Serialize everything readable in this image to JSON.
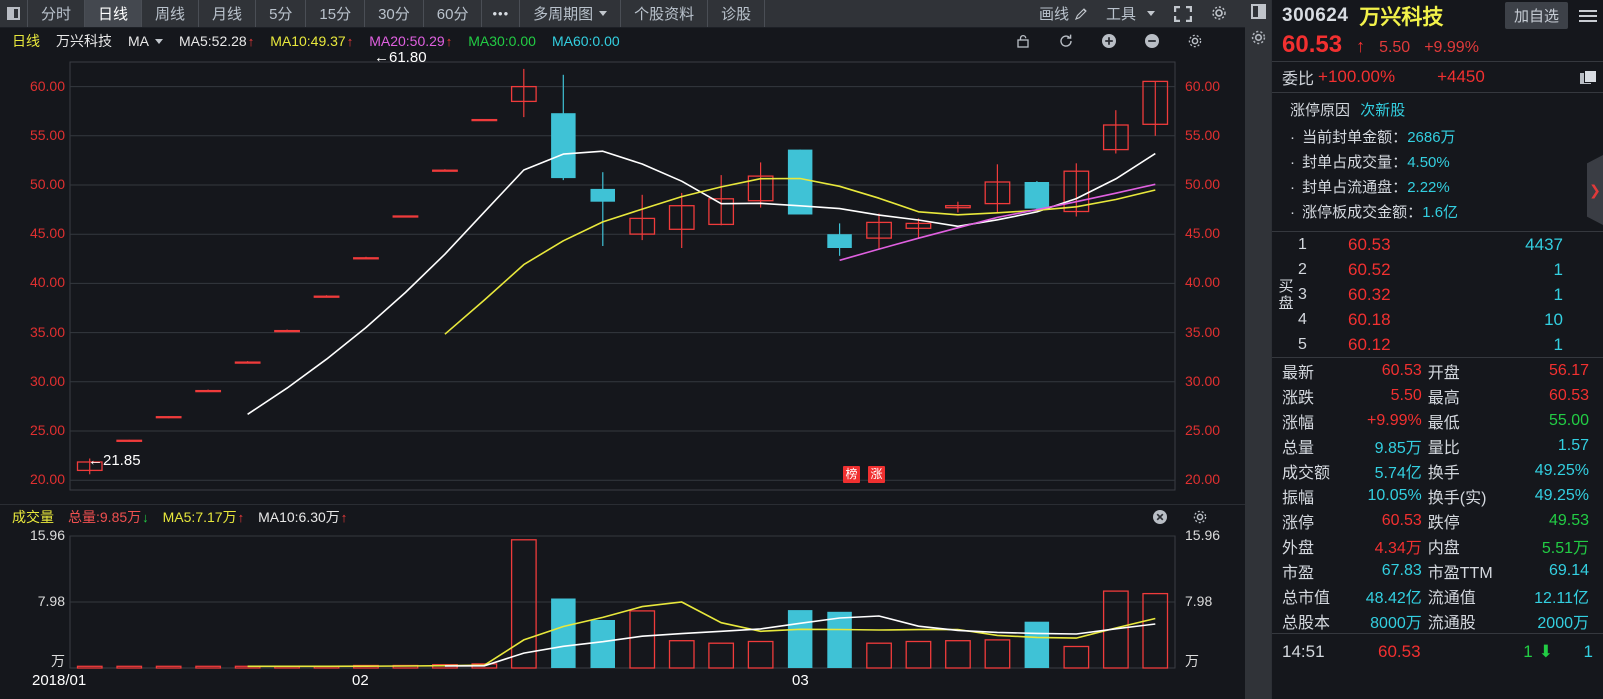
{
  "toolbar": {
    "panel_icon": "panel-toggle-icon",
    "tabs": [
      {
        "label": "分时",
        "active": false
      },
      {
        "label": "日线",
        "active": true
      },
      {
        "label": "周线",
        "active": false
      },
      {
        "label": "月线",
        "active": false
      },
      {
        "label": "5分",
        "active": false
      },
      {
        "label": "15分",
        "active": false
      },
      {
        "label": "30分",
        "active": false
      },
      {
        "label": "60分",
        "active": false
      }
    ],
    "more_label": "•••",
    "multi_period_label": "多周期图",
    "stock_info_label": "个股资料",
    "diagnose_label": "诊股",
    "draw_label": "画线",
    "tools_label": "工具"
  },
  "indicator_bar": {
    "period": "日线",
    "stock_name": "万兴科技",
    "ma_label": "MA",
    "ma5": "MA5:52.28",
    "ma10": "MA10:49.37",
    "ma20": "MA20:50.29",
    "ma30": "MA30:0.00",
    "ma60": "MA60:0.00"
  },
  "volume_header": {
    "title": "成交量",
    "total": "总量:9.85万",
    "ma5": "MA5:7.17万",
    "ma10": "MA10:6.30万"
  },
  "chart_data": {
    "type": "candlestick",
    "title": "万兴科技 300624 日线",
    "xlabel": "",
    "ylabel": "",
    "ylim": [
      19.0,
      62.5
    ],
    "y_ticks": [
      "60.00",
      "55.00",
      "50.00",
      "45.00",
      "40.00",
      "35.00",
      "30.00",
      "25.00",
      "20.00"
    ],
    "x_ticks": [
      "2018/01",
      "02",
      "03"
    ],
    "grid": true,
    "annotations": [
      {
        "text": "←61.80",
        "value": 61.8,
        "type": "high-marker"
      },
      {
        "text": "←21.85",
        "value": 21.85,
        "type": "low-marker"
      }
    ],
    "badges": [
      "榜",
      "涨"
    ],
    "legend": [
      {
        "name": "MA5",
        "color": "#ffffff",
        "value": 52.28
      },
      {
        "name": "MA10",
        "color": "#e8e83c",
        "value": 49.37
      },
      {
        "name": "MA20",
        "color": "#e060e0",
        "value": 50.29
      },
      {
        "name": "MA30",
        "color": "#22cc44",
        "value": 0.0
      },
      {
        "name": "MA60",
        "color": "#33cfe0",
        "value": 0.0
      }
    ],
    "candles": [
      {
        "o": 21.0,
        "h": 22.2,
        "l": 20.6,
        "c": 21.85,
        "dir": "up"
      },
      {
        "o": 24.0,
        "h": 24.1,
        "l": 23.9,
        "c": 24.05,
        "dir": "up"
      },
      {
        "o": 26.4,
        "h": 26.5,
        "l": 26.3,
        "c": 26.45,
        "dir": "up"
      },
      {
        "o": 29.1,
        "h": 29.2,
        "l": 29.0,
        "c": 29.1,
        "dir": "up"
      },
      {
        "o": 32.0,
        "h": 32.1,
        "l": 31.9,
        "c": 32.0,
        "dir": "up"
      },
      {
        "o": 35.2,
        "h": 35.3,
        "l": 35.1,
        "c": 35.2,
        "dir": "up"
      },
      {
        "o": 38.7,
        "h": 38.8,
        "l": 38.6,
        "c": 38.7,
        "dir": "up"
      },
      {
        "o": 42.6,
        "h": 42.7,
        "l": 42.5,
        "c": 42.6,
        "dir": "up"
      },
      {
        "o": 46.8,
        "h": 46.9,
        "l": 46.7,
        "c": 46.85,
        "dir": "up"
      },
      {
        "o": 51.5,
        "h": 51.6,
        "l": 51.4,
        "c": 51.5,
        "dir": "up"
      },
      {
        "o": 56.6,
        "h": 56.7,
        "l": 56.5,
        "c": 56.65,
        "dir": "up"
      },
      {
        "o": 58.5,
        "h": 61.8,
        "l": 56.9,
        "c": 60.0,
        "dir": "up"
      },
      {
        "o": 57.3,
        "h": 61.2,
        "l": 50.5,
        "c": 50.7,
        "dir": "down"
      },
      {
        "o": 49.6,
        "h": 51.3,
        "l": 43.8,
        "c": 48.3,
        "dir": "down"
      },
      {
        "o": 46.6,
        "h": 49.0,
        "l": 44.4,
        "c": 45.0,
        "dir": "up"
      },
      {
        "o": 45.5,
        "h": 49.2,
        "l": 43.6,
        "c": 47.9,
        "dir": "up"
      },
      {
        "o": 46.0,
        "h": 51.0,
        "l": 45.9,
        "c": 48.6,
        "dir": "up"
      },
      {
        "o": 48.4,
        "h": 52.3,
        "l": 47.7,
        "c": 50.9,
        "dir": "up"
      },
      {
        "o": 53.6,
        "h": 53.6,
        "l": 47.0,
        "c": 47.0,
        "dir": "down"
      },
      {
        "o": 45.0,
        "h": 46.1,
        "l": 42.8,
        "c": 43.6,
        "dir": "down"
      },
      {
        "o": 46.2,
        "h": 47.1,
        "l": 43.5,
        "c": 44.6,
        "dir": "up"
      },
      {
        "o": 45.6,
        "h": 46.6,
        "l": 44.6,
        "c": 46.1,
        "dir": "up"
      },
      {
        "o": 47.9,
        "h": 48.3,
        "l": 47.2,
        "c": 47.7,
        "dir": "up"
      },
      {
        "o": 48.1,
        "h": 52.1,
        "l": 47.1,
        "c": 50.3,
        "dir": "up"
      },
      {
        "o": 50.3,
        "h": 50.4,
        "l": 47.4,
        "c": 47.6,
        "dir": "down"
      },
      {
        "o": 47.3,
        "h": 52.2,
        "l": 46.8,
        "c": 51.4,
        "dir": "up"
      },
      {
        "o": 53.6,
        "h": 57.6,
        "l": 53.2,
        "c": 56.1,
        "dir": "up"
      },
      {
        "o": 56.17,
        "h": 60.53,
        "l": 55.0,
        "c": 60.53,
        "dir": "up"
      }
    ],
    "volume": {
      "type": "bar",
      "ylabel": "万",
      "y_ticks": [
        "15.96",
        "7.98",
        "万"
      ],
      "ylim": [
        0,
        15.96
      ],
      "values": [
        0.2,
        0.2,
        0.2,
        0.2,
        0.2,
        0.2,
        0.2,
        0.3,
        0.3,
        0.4,
        0.5,
        15.5,
        8.4,
        5.8,
        6.9,
        3.3,
        3.0,
        3.2,
        7.0,
        6.8,
        3.0,
        3.2,
        3.3,
        3.4,
        5.6,
        2.6,
        9.3,
        9.0
      ],
      "ma5_color": "#e8e83c",
      "ma10_color": "#ffffff"
    }
  },
  "quote": {
    "code": "300624",
    "name": "万兴科技",
    "add_watch": "加自选",
    "price": "60.53",
    "change": "5.50",
    "change_pct": "+9.99%",
    "weibi_label": "委比",
    "weibi_value": "+100.00%",
    "weibi_amount": "+4450",
    "reason": {
      "title": "涨停原因",
      "tag": "次新股",
      "rows": [
        {
          "k": "当前封单金额：",
          "v": "2686万"
        },
        {
          "k": "封单占成交量：",
          "v": "4.50%"
        },
        {
          "k": "封单占流通盘：",
          "v": "2.22%"
        },
        {
          "k": "涨停板成交金额：",
          "v": "1.6亿"
        }
      ]
    },
    "book_side_label": "买盘",
    "book": [
      {
        "n": "1",
        "p": "60.53",
        "q": "4437"
      },
      {
        "n": "2",
        "p": "60.52",
        "q": "1"
      },
      {
        "n": "3",
        "p": "60.32",
        "q": "1"
      },
      {
        "n": "4",
        "p": "60.18",
        "q": "10"
      },
      {
        "n": "5",
        "p": "60.12",
        "q": "1"
      }
    ],
    "stats": [
      {
        "k": "最新",
        "v": "60.53",
        "vc": "red",
        "k2": "开盘",
        "v2": "56.17",
        "v2c": "red"
      },
      {
        "k": "涨跌",
        "v": "5.50",
        "vc": "red",
        "k2": "最高",
        "v2": "60.53",
        "v2c": "red"
      },
      {
        "k": "涨幅",
        "v": "+9.99%",
        "vc": "red",
        "k2": "最低",
        "v2": "55.00",
        "v2c": "green"
      },
      {
        "k": "总量",
        "v": "9.85万",
        "vc": "cyan",
        "k2": "量比",
        "v2": "1.57",
        "v2c": "cyan"
      },
      {
        "k": "成交额",
        "v": "5.74亿",
        "vc": "cyan",
        "k2": "换手",
        "v2": "49.25%",
        "v2c": "cyan"
      },
      {
        "k": "振幅",
        "v": "10.05%",
        "vc": "cyan",
        "k2": "换手(实)",
        "v2": "49.25%",
        "v2c": "cyan"
      },
      {
        "k": "涨停",
        "v": "60.53",
        "vc": "red",
        "k2": "跌停",
        "v2": "49.53",
        "v2c": "green"
      },
      {
        "k": "外盘",
        "v": "4.34万",
        "vc": "red",
        "k2": "内盘",
        "v2": "5.51万",
        "v2c": "green"
      },
      {
        "k": "市盈",
        "v": "67.83",
        "vc": "cyan",
        "k2": "市盈TTM",
        "v2": "69.14",
        "v2c": "cyan"
      },
      {
        "k": "总市值",
        "v": "48.42亿",
        "vc": "cyan",
        "k2": "流通值",
        "v2": "12.11亿",
        "v2c": "cyan"
      },
      {
        "k": "总股本",
        "v": "8000万",
        "vc": "cyan",
        "k2": "流通股",
        "v2": "2000万",
        "v2c": "cyan"
      }
    ],
    "tick": {
      "time": "14:51",
      "price": "60.53",
      "vol": "1",
      "dir": "down",
      "count": "1"
    }
  }
}
